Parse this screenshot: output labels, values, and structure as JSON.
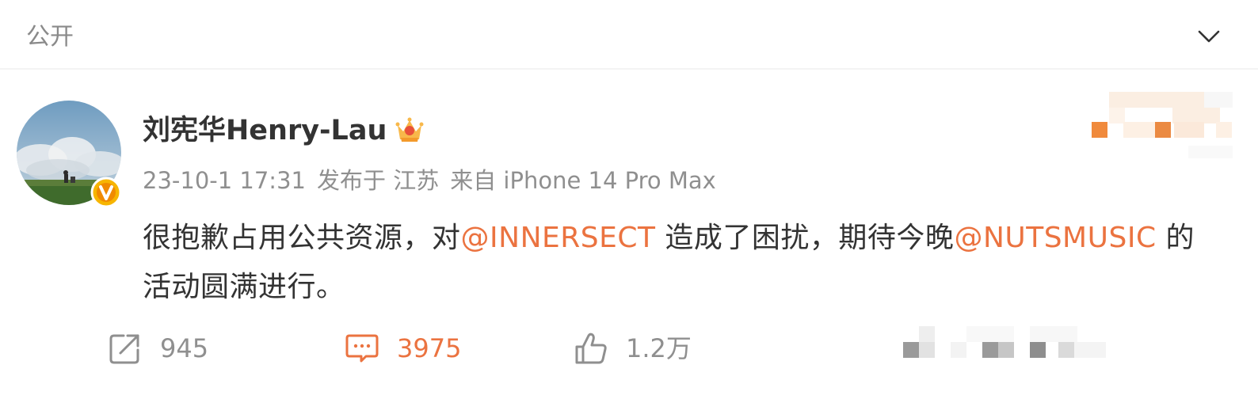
{
  "visibility": {
    "label": "公开",
    "dropdown_icon": "chevron-down-icon"
  },
  "author": {
    "name": "刘宪华Henry-Lau",
    "avatar_icon": "avatar-landscape",
    "badge_icon": "verified-v-icon",
    "member_icon": "crown-icon"
  },
  "meta": {
    "timestamp": "23-10-1 17:31",
    "location": "发布于 江苏",
    "source": "来自 iPhone 14 Pro Max"
  },
  "post": {
    "text_1": "很抱歉占用公共资源，对",
    "mention_1": "@INNERSECT",
    "text_2": " 造成了困扰，期待今晚",
    "mention_2": "@NUTSMUSIC",
    "text_3": " 的活动圆满进行。"
  },
  "actions": {
    "repost": {
      "icon": "share-icon",
      "count": "945"
    },
    "comment": {
      "icon": "comment-icon",
      "count": "3975"
    },
    "like": {
      "icon": "thumbs-up-icon",
      "count": "1.2万"
    }
  },
  "colors": {
    "accent": "#eb7340",
    "text": "#333333",
    "muted": "#8f8f8f",
    "gold": "#f5a623"
  }
}
